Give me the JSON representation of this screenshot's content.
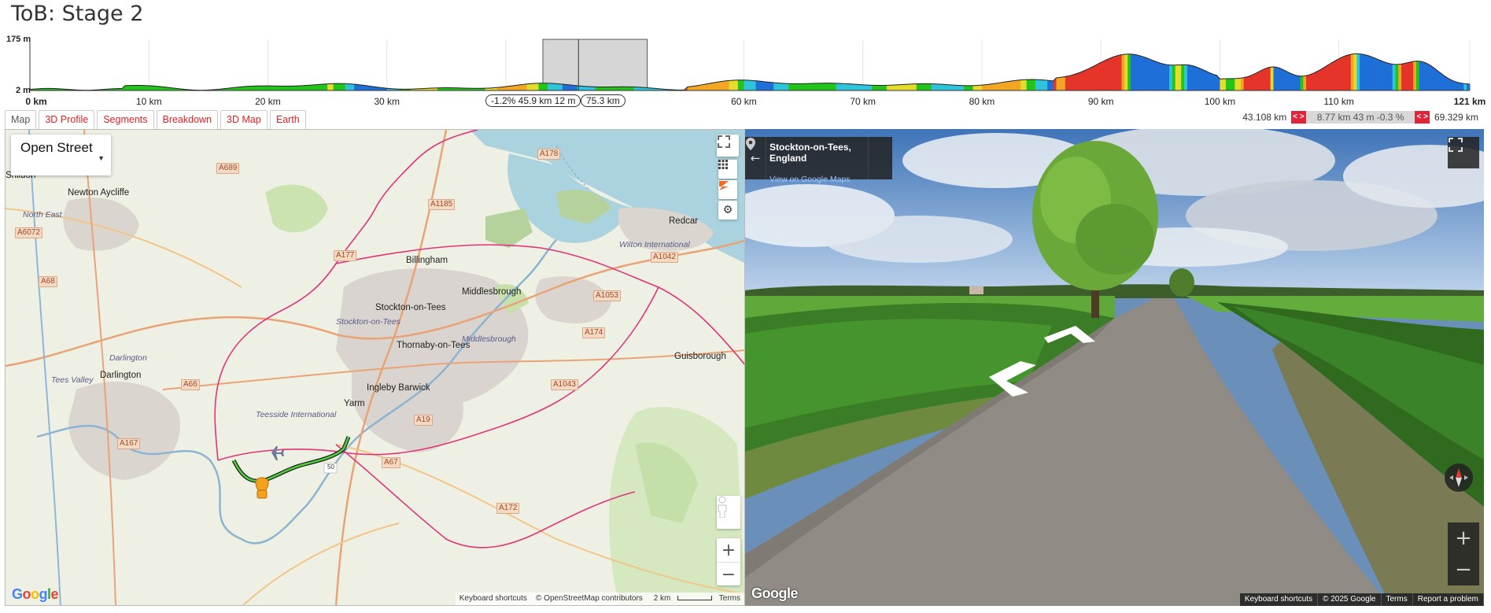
{
  "page": {
    "title": "ToB: Stage 2"
  },
  "profile": {
    "y_max_label": "175 m",
    "y_min_label": "2 m",
    "x_ticks": [
      "0 km",
      "10 km",
      "20 km",
      "30 km",
      "40 km",
      "50 km",
      "60 km",
      "70 km",
      "80 km",
      "90 km",
      "100 km",
      "110 km",
      "121 km"
    ],
    "x_tick_values": [
      0,
      10,
      20,
      30,
      40,
      50,
      60,
      70,
      80,
      90,
      100,
      110,
      121
    ],
    "selection_info": "-1.2% 45.9 km 12 m",
    "cursor_info": "75.3 km",
    "selection_range_km": [
      43.108,
      51.878
    ],
    "cursor_km": 46.1
  },
  "tabs": [
    {
      "label": "Map",
      "active": true
    },
    {
      "label": "3D Profile"
    },
    {
      "label": "Segments"
    },
    {
      "label": "Breakdown"
    },
    {
      "label": "3D Map"
    },
    {
      "label": "Earth"
    }
  ],
  "range_bar": {
    "start": "43.108 km",
    "segment": "8.77 km 43 m -0.3 %",
    "end": "69.329 km",
    "nav_left": "< >",
    "nav_right": "< >"
  },
  "map": {
    "layer": "Open Street",
    "scale": "2 km",
    "attribution": {
      "keyboard": "Keyboard shortcuts",
      "osm": "© OpenStreetMap contributors",
      "terms": "Terms"
    },
    "google": "Google",
    "places": [
      "Newton Aycliffe",
      "Billingham",
      "Redcar",
      "Middlesbrough",
      "Stockton-on-Tees",
      "Thornaby-on-Tees",
      "Ingleby Barwick",
      "Darlington",
      "Yarm",
      "Guisborough",
      "Shildon"
    ],
    "italic_places": [
      "Tees Valley",
      "Wilton International",
      "Stockton-on-Tees",
      "Middlesbrough",
      "Darlington",
      "Teesside International",
      "North East"
    ],
    "roads": [
      "A689",
      "A1185",
      "A177",
      "A1042",
      "A1053",
      "A174",
      "A6072",
      "A68",
      "A66",
      "A1043",
      "A167",
      "A67",
      "A172",
      "A19",
      "A178"
    ],
    "route_marker": "50"
  },
  "streetview": {
    "place": "Stockton-on-Tees, England",
    "link": "View on Google Maps",
    "google": "Google",
    "attribution": [
      "Keyboard shortcuts",
      "© 2025 Google",
      "Terms",
      "Report a problem"
    ]
  },
  "colors": {
    "accent_tab": "#dd2222",
    "range_btn": "#e0243a",
    "route_pink": "#e0347a",
    "profile_green": "#22c41a"
  }
}
